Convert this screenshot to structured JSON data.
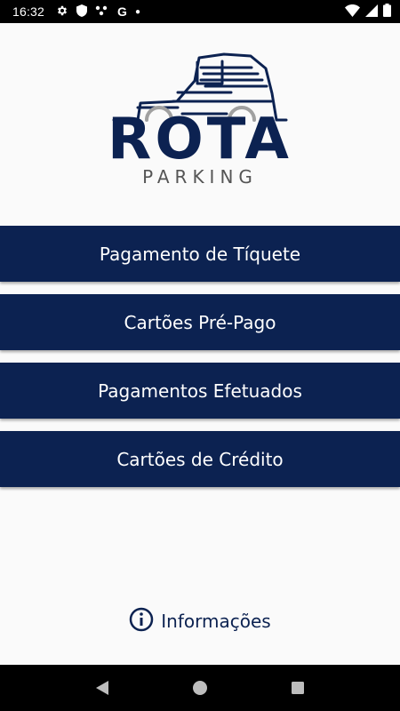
{
  "status_bar": {
    "time": "16:32",
    "notification_letter": "G",
    "icons": [
      "gear-icon",
      "shield-icon",
      "dots-icon",
      "google-icon",
      "dot-icon",
      "wifi-icon",
      "signal-icon",
      "battery-icon"
    ]
  },
  "logo": {
    "brand": "ROTA",
    "subtitle": "PARKING"
  },
  "menu": {
    "items": [
      {
        "label": "Pagamento de Tíquete"
      },
      {
        "label": "Cartões Pré-Pago"
      },
      {
        "label": "Pagamentos Efetuados"
      },
      {
        "label": "Cartões de Crédito"
      }
    ]
  },
  "info": {
    "label": "Informações",
    "icon": "info-icon"
  },
  "nav_bar": {
    "icons": [
      "back-icon",
      "home-icon",
      "recents-icon"
    ]
  },
  "colors": {
    "primary": "#0c2251",
    "background": "#fafafa",
    "logo_gray": "#a0a0a0",
    "logo_subtitle": "#555555"
  }
}
